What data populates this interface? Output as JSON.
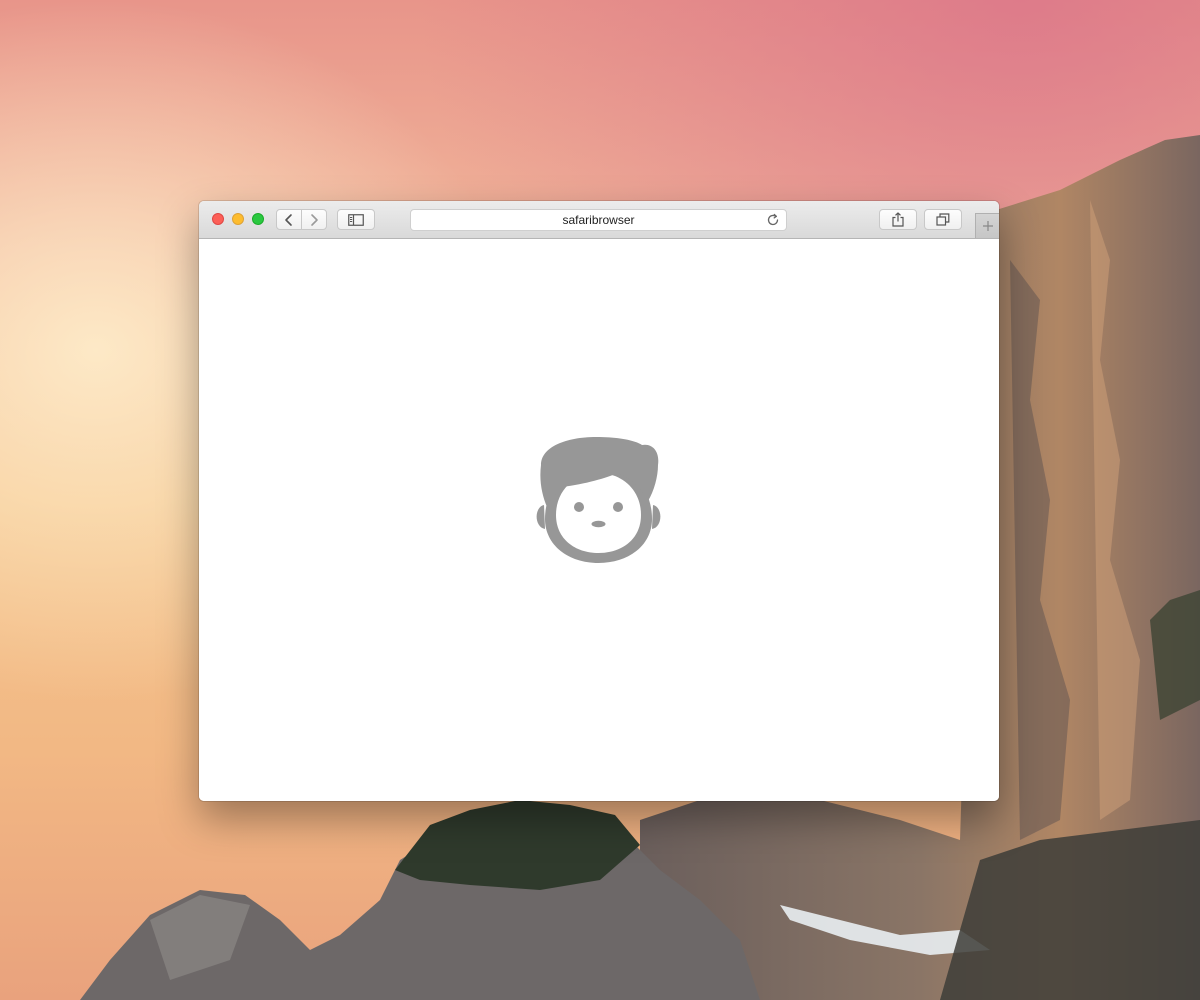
{
  "browser": {
    "address": {
      "url_text": "safaribrowser"
    },
    "toolbar": {
      "traffic_lights": [
        "close",
        "minimize",
        "zoom"
      ],
      "buttons": [
        "back",
        "forward",
        "sidebar",
        "share",
        "tabs-overview",
        "new-tab"
      ]
    },
    "content": {
      "icon": "user-face-icon",
      "icon_color": "#979797"
    }
  },
  "colors": {
    "close": "#fc5f57",
    "minimize": "#fdbc2e",
    "zoom": "#2ac840"
  }
}
